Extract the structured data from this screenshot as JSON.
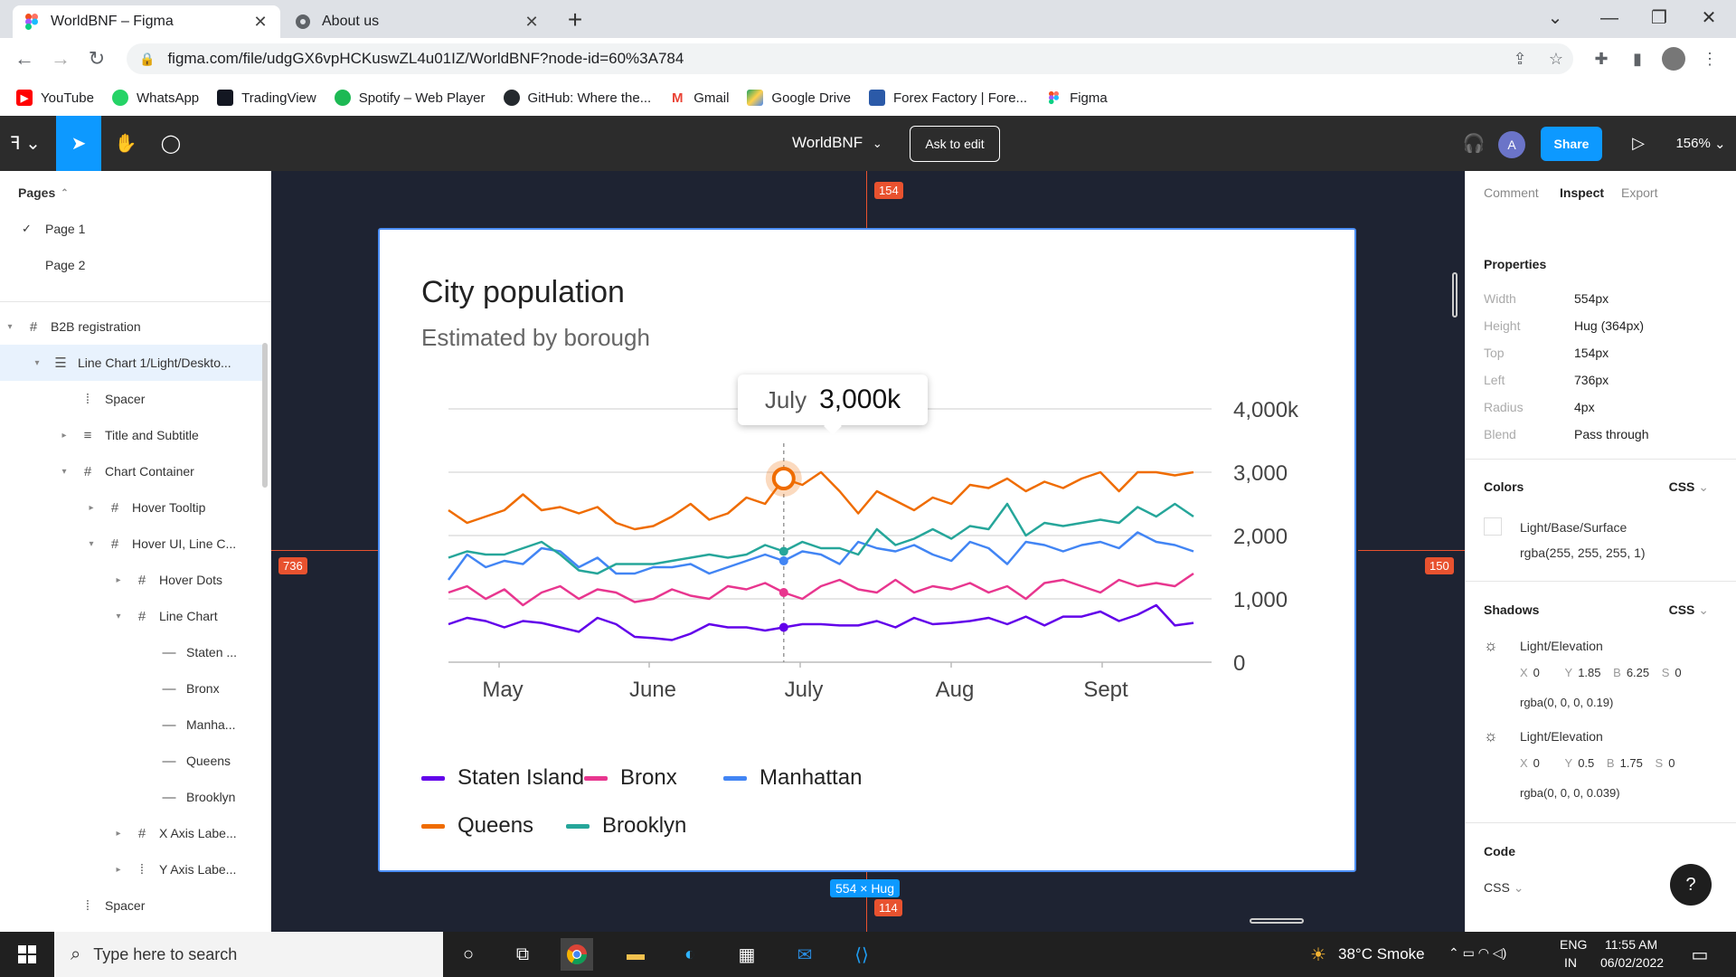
{
  "browser": {
    "tabs": [
      {
        "title": "WorldBNF – Figma",
        "icon": "figma-icon",
        "active": true
      },
      {
        "title": "About us",
        "icon": "globe-icon",
        "active": false
      }
    ],
    "url": "figma.com/file/udgGX6vpHCKuswZL4u01IZ/WorldBNF?node-id=60%3A784",
    "bookmarks": [
      {
        "label": "YouTube",
        "icon": "youtube-icon",
        "color": "#ff0000"
      },
      {
        "label": "WhatsApp",
        "icon": "whatsapp-icon",
        "color": "#25d366"
      },
      {
        "label": "TradingView",
        "icon": "tradingview-icon",
        "color": "#131722"
      },
      {
        "label": "Spotify – Web Player",
        "icon": "spotify-icon",
        "color": "#1db954"
      },
      {
        "label": "GitHub: Where the...",
        "icon": "github-icon",
        "color": "#24292e"
      },
      {
        "label": "Gmail",
        "icon": "gmail-icon",
        "color": "#ea4335"
      },
      {
        "label": "Google Drive",
        "icon": "google-drive-icon",
        "color": "#1fa463"
      },
      {
        "label": "Forex Factory | Fore...",
        "icon": "forex-factory-icon",
        "color": "#2b5aa8"
      },
      {
        "label": "Figma",
        "icon": "figma-icon",
        "color": "#f24e1e"
      }
    ]
  },
  "figma": {
    "file_name": "WorldBNF",
    "ask_to_edit": "Ask to edit",
    "share": "Share",
    "avatar": "A",
    "zoom": "156%",
    "accent": "#0d99ff"
  },
  "layers": {
    "pages_header": "Pages",
    "pages": [
      "Page 1",
      "Page 2"
    ],
    "tree": [
      {
        "label": "B2B registration",
        "glyph": "#",
        "indent": 0,
        "caret": "▾"
      },
      {
        "label": "Line Chart 1/Light/Deskto...",
        "glyph": "☰",
        "indent": 1,
        "caret": "▾",
        "selected": true
      },
      {
        "label": "Spacer",
        "glyph": "⁞",
        "indent": 2,
        "caret": ""
      },
      {
        "label": "Title and Subtitle",
        "glyph": "≡",
        "indent": 2,
        "caret": "▸"
      },
      {
        "label": "Chart Container",
        "glyph": "#",
        "indent": 2,
        "caret": "▾"
      },
      {
        "label": "Hover Tooltip",
        "glyph": "#",
        "indent": 3,
        "caret": "▸"
      },
      {
        "label": "Hover UI, Line C...",
        "glyph": "#",
        "indent": 3,
        "caret": "▾"
      },
      {
        "label": "Hover Dots",
        "glyph": "#",
        "indent": 4,
        "caret": "▸"
      },
      {
        "label": "Line Chart",
        "glyph": "#",
        "indent": 4,
        "caret": "▾"
      },
      {
        "label": "Staten ...",
        "glyph": "—",
        "indent": 5,
        "caret": ""
      },
      {
        "label": "Bronx",
        "glyph": "—",
        "indent": 5,
        "caret": ""
      },
      {
        "label": "Manha...",
        "glyph": "—",
        "indent": 5,
        "caret": ""
      },
      {
        "label": "Queens",
        "glyph": "—",
        "indent": 5,
        "caret": ""
      },
      {
        "label": "Brooklyn",
        "glyph": "—",
        "indent": 5,
        "caret": ""
      },
      {
        "label": "X Axis Labe...",
        "glyph": "#",
        "indent": 4,
        "caret": "▸"
      },
      {
        "label": "Y Axis Labe...",
        "glyph": "⁞",
        "indent": 4,
        "caret": "▸"
      },
      {
        "label": "Spacer",
        "glyph": "⁞",
        "indent": 2,
        "caret": ""
      }
    ]
  },
  "canvas": {
    "measure_top": "154",
    "measure_left": "736",
    "measure_right": "150",
    "measure_bottom": "114",
    "size_label": "554 × Hug"
  },
  "chart_data": {
    "type": "line",
    "title": "City population",
    "subtitle": "Estimated by borough",
    "categories": [
      "May",
      "June",
      "July",
      "Aug",
      "Sept"
    ],
    "y_ticks": [
      "4,000k",
      "3,000",
      "2,000",
      "1,000",
      "0"
    ],
    "ylim": [
      0,
      4000
    ],
    "grid": true,
    "legend": "bottom",
    "tooltip": {
      "month": "July",
      "value": "3,000k"
    },
    "hover_index": 18,
    "series": [
      {
        "name": "Staten Island",
        "color": "#6200ea",
        "values": [
          600,
          700,
          650,
          550,
          650,
          620,
          550,
          480,
          700,
          600,
          400,
          380,
          350,
          450,
          600,
          550,
          550,
          500,
          550,
          600,
          600,
          580,
          580,
          650,
          550,
          700,
          600,
          620,
          650,
          700,
          600,
          720,
          580,
          720,
          720,
          800,
          650,
          750,
          900,
          580,
          620
        ]
      },
      {
        "name": "Bronx",
        "color": "#e8368f",
        "values": [
          1100,
          1200,
          1000,
          1150,
          900,
          1100,
          1200,
          1000,
          1150,
          1100,
          950,
          1000,
          1150,
          1050,
          1000,
          1200,
          1150,
          1250,
          1100,
          1000,
          1200,
          1300,
          1150,
          1100,
          1300,
          1100,
          1200,
          1150,
          1250,
          1100,
          1200,
          1000,
          1250,
          1300,
          1200,
          1100,
          1300,
          1200,
          1250,
          1200,
          1400
        ]
      },
      {
        "name": "Manhattan",
        "color": "#4285f4",
        "values": [
          1300,
          1700,
          1500,
          1600,
          1550,
          1800,
          1750,
          1500,
          1650,
          1400,
          1400,
          1500,
          1500,
          1550,
          1400,
          1500,
          1600,
          1700,
          1600,
          1750,
          1700,
          1550,
          1900,
          1800,
          1750,
          1850,
          1700,
          1600,
          1900,
          1800,
          1550,
          1900,
          1850,
          1750,
          1850,
          1900,
          1800,
          2050,
          1900,
          1850,
          1750
        ]
      },
      {
        "name": "Queens",
        "color": "#ef6c00",
        "values": [
          2400,
          2200,
          2300,
          2400,
          2650,
          2400,
          2450,
          2350,
          2450,
          2200,
          2100,
          2150,
          2300,
          2500,
          2250,
          2350,
          2600,
          2500,
          2900,
          2800,
          3000,
          2700,
          2350,
          2700,
          2550,
          2400,
          2600,
          2500,
          2800,
          2750,
          2900,
          2700,
          2850,
          2750,
          2900,
          3000,
          2700,
          3000,
          3000,
          2950,
          3000
        ]
      },
      {
        "name": "Brooklyn",
        "color": "#26a69a",
        "values": [
          1650,
          1750,
          1700,
          1700,
          1800,
          1900,
          1700,
          1450,
          1400,
          1550,
          1550,
          1550,
          1600,
          1650,
          1700,
          1650,
          1700,
          1850,
          1750,
          1900,
          1800,
          1800,
          1700,
          2100,
          1850,
          1950,
          2100,
          1950,
          2150,
          2100,
          2500,
          2000,
          2200,
          2150,
          2200,
          2250,
          2200,
          2450,
          2300,
          2500,
          2300
        ]
      }
    ]
  },
  "inspect": {
    "tabs": [
      "Comment",
      "Inspect",
      "Export"
    ],
    "properties_header": "Properties",
    "properties": [
      {
        "key": "Width",
        "value": "554px"
      },
      {
        "key": "Height",
        "value": "Hug (364px)"
      },
      {
        "key": "Top",
        "value": "154px"
      },
      {
        "key": "Left",
        "value": "736px"
      },
      {
        "key": "Radius",
        "value": "4px"
      },
      {
        "key": "Blend",
        "value": "Pass through"
      }
    ],
    "colors_header": "Colors",
    "css_label": "CSS",
    "color_name": "Light/Base/Surface",
    "color_value": "rgba(255, 255, 255, 1)",
    "shadows_header": "Shadows",
    "shadows": [
      {
        "name": "Light/Elevation",
        "x": "0",
        "y": "1.85",
        "b": "6.25",
        "s": "0",
        "rgba": "rgba(0, 0, 0, 0.19)"
      },
      {
        "name": "Light/Elevation",
        "x": "0",
        "y": "0.5",
        "b": "1.75",
        "s": "0",
        "rgba": "rgba(0, 0, 0, 0.039)"
      }
    ],
    "code_header": "Code",
    "code_lang": "CSS",
    "help": "?"
  },
  "taskbar": {
    "search_placeholder": "Type here to search",
    "weather": "38°C Smoke",
    "lang": "ENG",
    "region": "IN",
    "time": "11:55 AM",
    "date": "06/02/2022"
  }
}
